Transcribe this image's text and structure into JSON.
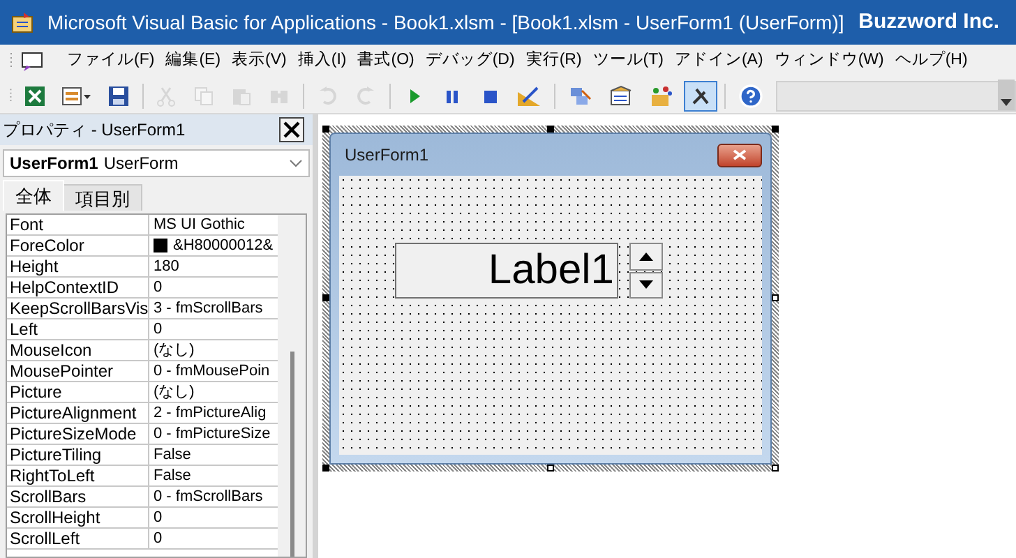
{
  "window": {
    "title": "Microsoft Visual Basic for Applications - Book1.xlsm - [Book1.xlsm - UserForm1 (UserForm)]",
    "brand": "Buzzword Inc."
  },
  "menu": [
    {
      "label": "ファイル(F)"
    },
    {
      "label": "編集(E)"
    },
    {
      "label": "表示(V)"
    },
    {
      "label": "挿入(I)"
    },
    {
      "label": "書式(O)"
    },
    {
      "label": "デバッグ(D)"
    },
    {
      "label": "実行(R)"
    },
    {
      "label": "ツール(T)"
    },
    {
      "label": "アドイン(A)"
    },
    {
      "label": "ウィンドウ(W)"
    },
    {
      "label": "ヘルプ(H)"
    }
  ],
  "toolbar": [
    {
      "kind": "excel",
      "disabled": false,
      "selected": false
    },
    {
      "kind": "insert",
      "disabled": false,
      "selected": false
    },
    {
      "kind": "save",
      "disabled": false,
      "selected": false
    },
    {
      "kind": "sep"
    },
    {
      "kind": "cut",
      "disabled": true,
      "selected": false
    },
    {
      "kind": "copy",
      "disabled": true,
      "selected": false
    },
    {
      "kind": "paste",
      "disabled": true,
      "selected": false
    },
    {
      "kind": "find",
      "disabled": true,
      "selected": false
    },
    {
      "kind": "sep"
    },
    {
      "kind": "undo",
      "disabled": true,
      "selected": false
    },
    {
      "kind": "redo",
      "disabled": true,
      "selected": false
    },
    {
      "kind": "sep"
    },
    {
      "kind": "run",
      "disabled": false,
      "selected": false
    },
    {
      "kind": "pause",
      "disabled": false,
      "selected": false
    },
    {
      "kind": "stop",
      "disabled": false,
      "selected": false
    },
    {
      "kind": "design",
      "disabled": false,
      "selected": false
    },
    {
      "kind": "sep"
    },
    {
      "kind": "project",
      "disabled": false,
      "selected": false
    },
    {
      "kind": "properties",
      "disabled": false,
      "selected": false
    },
    {
      "kind": "objects",
      "disabled": false,
      "selected": false
    },
    {
      "kind": "toolbox",
      "disabled": false,
      "selected": true
    },
    {
      "kind": "sep"
    },
    {
      "kind": "help",
      "disabled": false,
      "selected": false
    }
  ],
  "properties": {
    "title": "プロパティ - UserForm1",
    "object_name": "UserForm1",
    "object_type": "UserForm",
    "tabs": [
      {
        "label": "全体",
        "selected": true
      },
      {
        "label": "項目別",
        "selected": false
      }
    ],
    "rows": [
      {
        "name": "Font",
        "value": "MS UI Gothic"
      },
      {
        "name": "ForeColor",
        "value": "&H80000012&",
        "color": "#000000"
      },
      {
        "name": "Height",
        "value": "180"
      },
      {
        "name": "HelpContextID",
        "value": "0"
      },
      {
        "name": "KeepScrollBarsVis",
        "value": "3 - fmScrollBars"
      },
      {
        "name": "Left",
        "value": "0"
      },
      {
        "name": "MouseIcon",
        "value": "(なし)"
      },
      {
        "name": "MousePointer",
        "value": "0 - fmMousePoin"
      },
      {
        "name": "Picture",
        "value": "(なし)"
      },
      {
        "name": "PictureAlignment",
        "value": "2 - fmPictureAlig"
      },
      {
        "name": "PictureSizeMode",
        "value": "0 - fmPictureSize"
      },
      {
        "name": "PictureTiling",
        "value": "False"
      },
      {
        "name": "RightToLeft",
        "value": "False"
      },
      {
        "name": "ScrollBars",
        "value": "0 - fmScrollBars"
      },
      {
        "name": "ScrollHeight",
        "value": "0"
      },
      {
        "name": "ScrollLeft",
        "value": "0"
      }
    ]
  },
  "form": {
    "title": "UserForm1",
    "label": "Label1"
  }
}
